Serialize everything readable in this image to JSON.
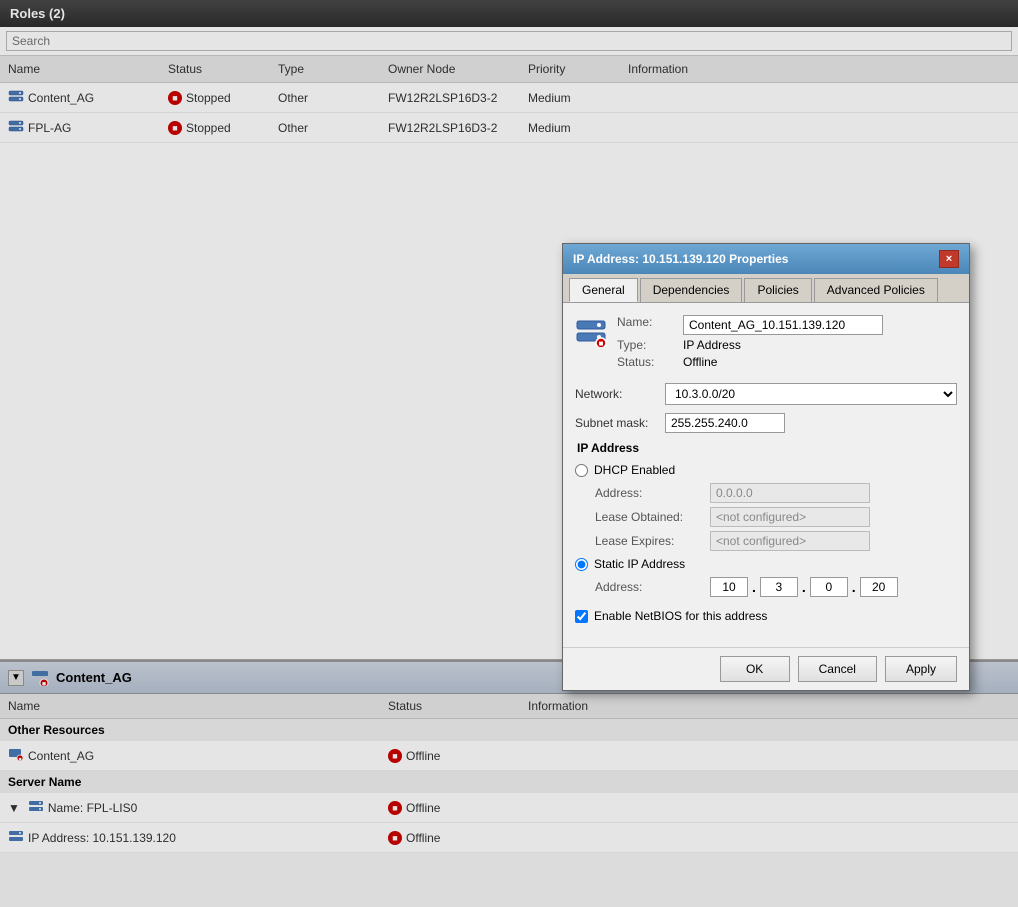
{
  "roles_panel": {
    "title": "Roles (2)",
    "search_placeholder": "Search",
    "columns": [
      "Name",
      "Status",
      "Type",
      "Owner Node",
      "Priority",
      "Information"
    ],
    "rows": [
      {
        "name": "Content_AG",
        "status": "Stopped",
        "type": "Other",
        "owner_node": "FW12R2LSP16D3-2",
        "priority": "Medium",
        "information": ""
      },
      {
        "name": "FPL-AG",
        "status": "Stopped",
        "type": "Other",
        "owner_node": "FW12R2LSP16D3-2",
        "priority": "Medium",
        "information": ""
      }
    ]
  },
  "bottom_panel": {
    "group_name": "Content_AG",
    "columns": [
      "Name",
      "Status",
      "Information"
    ],
    "sections": [
      {
        "label": "Other Resources",
        "rows": [
          {
            "name": "Content_AG",
            "status": "Offline",
            "indent": 1
          }
        ]
      },
      {
        "label": "Server Name",
        "rows": [
          {
            "name": "Name: FPL-LIS0",
            "status": "Offline",
            "indent": 1
          },
          {
            "name": "IP Address: 10.151.139.120",
            "status": "Offline",
            "indent": 2
          }
        ]
      }
    ]
  },
  "dialog": {
    "title": "IP Address: 10.151.139.120 Properties",
    "tabs": [
      "General",
      "Dependencies",
      "Policies",
      "Advanced Policies"
    ],
    "active_tab": "General",
    "close_label": "×",
    "name_value": "Content_AG_10.151.139.120",
    "type_value": "IP Address",
    "status_value": "Offline",
    "name_label": "Name:",
    "type_label": "Type:",
    "status_label": "Status:",
    "network_label": "Network:",
    "network_value": "10.3.0.0/20",
    "subnet_label": "Subnet mask:",
    "subnet_value": "255.255.240.0",
    "ip_address_section": "IP Address",
    "dhcp_label": "DHCP Enabled",
    "address_label": "Address:",
    "address_value": "0.0.0.0",
    "lease_obtained_label": "Lease Obtained:",
    "lease_obtained_value": "<not configured>",
    "lease_expires_label": "Lease Expires:",
    "lease_expires_value": "<not configured>",
    "static_label": "Static IP Address",
    "static_address_label": "Address:",
    "ip_parts": [
      "10",
      "3",
      "0",
      "20"
    ],
    "netbios_label": "Enable NetBIOS for this address",
    "ok_label": "OK",
    "cancel_label": "Cancel",
    "apply_label": "Apply"
  }
}
